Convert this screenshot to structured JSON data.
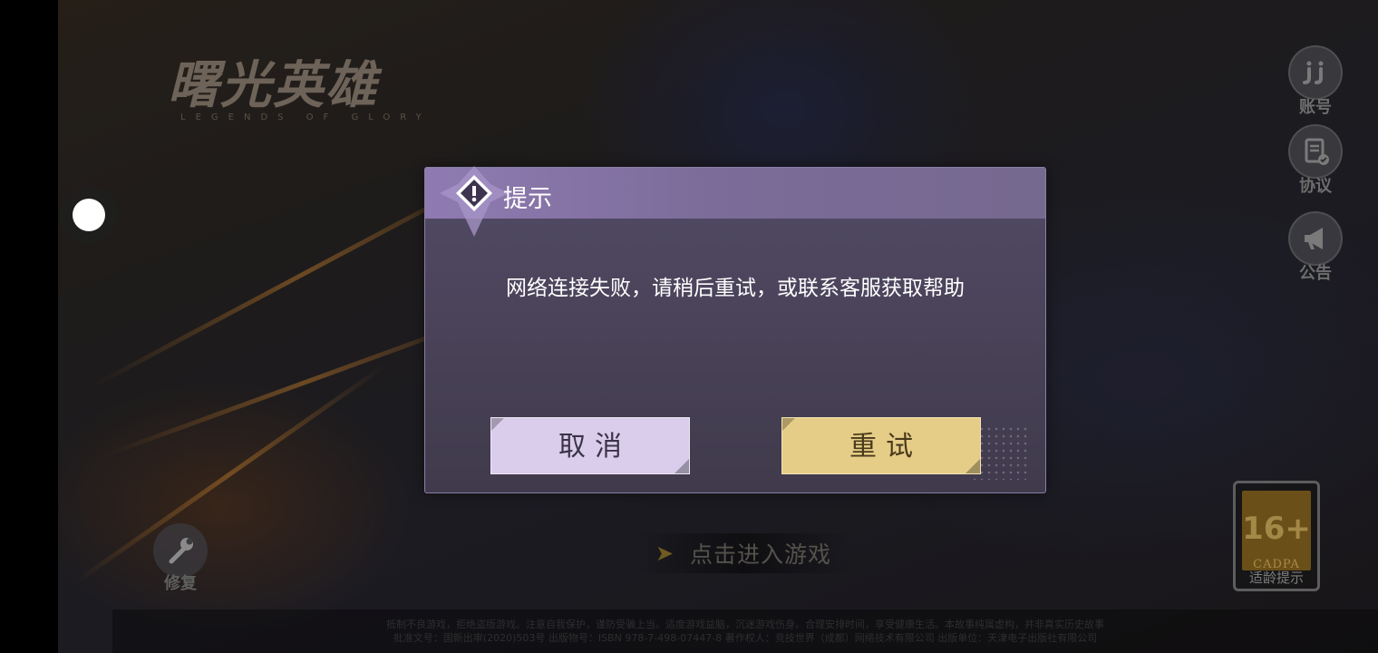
{
  "logo": {
    "title": "曙光英雄",
    "subtitle": "LEGENDS OF GLORY"
  },
  "side_menu": [
    {
      "label": "账号",
      "icon": "account-icon"
    },
    {
      "label": "协议",
      "icon": "agreement-icon"
    },
    {
      "label": "公告",
      "icon": "announcement-icon"
    }
  ],
  "repair": {
    "label": "修复",
    "icon": "wrench-icon"
  },
  "enter_game": {
    "label": "点击进入游戏",
    "icon": "play-arrow-icon"
  },
  "age_rating": {
    "age": "16+",
    "org": "CADPA",
    "label": "适龄提示"
  },
  "footer": {
    "line1": "抵制不良游戏，拒绝盗版游戏。注意自我保护，谨防受骗上当。适度游戏益脑，沉迷游戏伤身。合理安排时间，享受健康生活。本故事纯属虚构，并非真实历史故事",
    "line2": "批准文号：国新出审(2020)503号 出版物号：ISBN 978-7-498-07447-8 著作权人：竞技世界（成都）网络技术有限公司 出版单位：天津电子出版社有限公司"
  },
  "dialog": {
    "title": "提示",
    "message": "网络连接失败，请稍后重试，或联系客服获取帮助",
    "cancel_label": "取消",
    "retry_label": "重试"
  },
  "colors": {
    "dialog_header": "#8f7bb1",
    "cancel_button": "#d9cdeb",
    "retry_button": "#e6cd87"
  }
}
